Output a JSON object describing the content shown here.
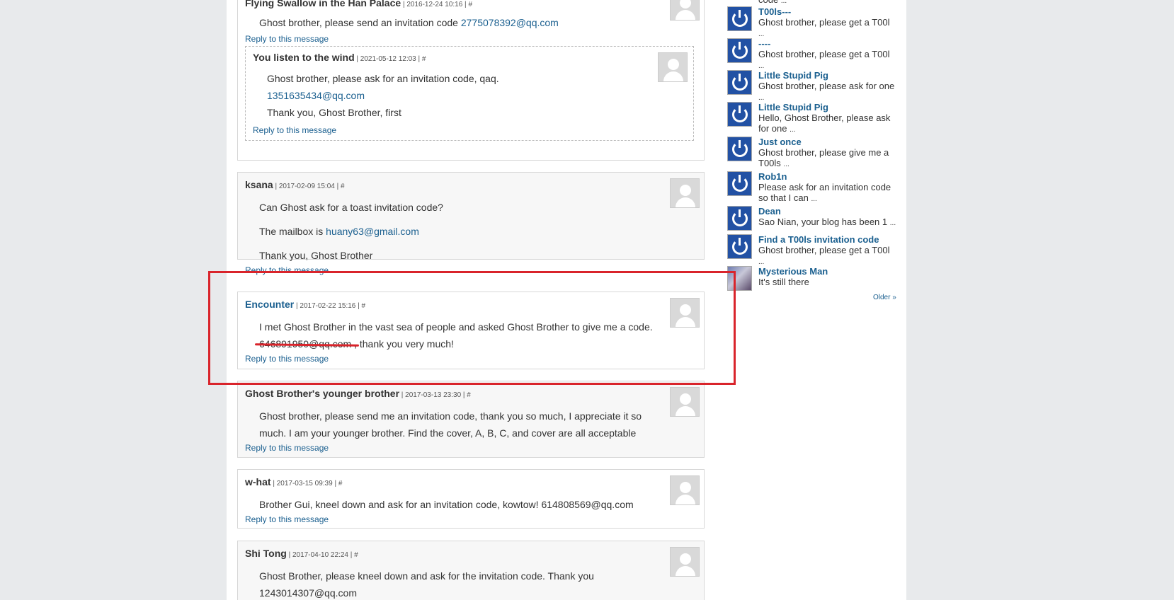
{
  "top_comment": {
    "author": "Flying Swallow in the Han Palace",
    "meta": " | 2016-12-24 10:16 | ",
    "hash": "#",
    "body_text": "Ghost brother, please send an invitation code ",
    "body_email": "2775078392@qq.com",
    "reply": "Reply to this message",
    "nested": {
      "author": "You listen to the wind",
      "meta": " | 2021-05-12 12:03 | ",
      "hash": "#",
      "line1": "Ghost brother, please ask for an invitation code, qaq.",
      "email": "1351635434@qq.com",
      "line3": "Thank you, Ghost Brother, first",
      "reply": "Reply to this message"
    }
  },
  "comments": [
    {
      "author": "ksana",
      "meta": " | 2017-02-09 15:04 | ",
      "hash": "#",
      "line1": "Can Ghost ask for a toast invitation code?",
      "line2_prefix": "The mailbox is ",
      "line2_email": "huany63@gmail.com",
      "line3": "Thank you, Ghost Brother",
      "reply": "Reply to this message"
    },
    {
      "author": "Encounter",
      "meta": " | 2017-02-22 15:16 | ",
      "hash": "#",
      "line1": "I met Ghost Brother in the vast sea of people and asked Ghost Brother to give me a code.",
      "line2_email": "646891950@qq.com",
      "line2_suffix": " , thank you very much!",
      "reply": "Reply to this message"
    },
    {
      "author": "Ghost Brother's younger brother",
      "meta": " | 2017-03-13 23:30 | ",
      "hash": "#",
      "line1": "Ghost brother, please send me an invitation code, thank you so much, I appreciate it so",
      "line2": "much. I am your younger brother. Find the cover, A, B, C, and cover are all acceptable",
      "reply": "Reply to this message"
    },
    {
      "author": "w-hat",
      "meta": " | 2017-03-15 09:39 | ",
      "hash": "#",
      "line1": "Brother Gui, kneel down and ask for an invitation code, kowtow! 614808569@qq.com",
      "reply": "Reply to this message"
    },
    {
      "author": "Shi Tong",
      "meta": " | 2017-04-10 22:24 | ",
      "hash": "#",
      "line1": "Ghost Brother, please kneel down and ask for the invitation code. Thank you",
      "line2": "1243014307@qq.com"
    }
  ],
  "sidebar": {
    "top_snippet": "code",
    "items": [
      {
        "name": "T00ls---",
        "snippet": "Ghost brother, please get a T00l"
      },
      {
        "name": "----",
        "snippet": "Ghost brother, please get a T00l"
      },
      {
        "name": "Little Stupid Pig",
        "snippet": "Ghost brother, please ask for one"
      },
      {
        "name": "Little Stupid Pig",
        "snippet": "Hello, Ghost Brother, please ask for one"
      },
      {
        "name": "Just once",
        "snippet": "Ghost brother, please give me a T00ls"
      },
      {
        "name": "Rob1n",
        "snippet": "Please ask for an invitation code so that I can"
      },
      {
        "name": "Dean",
        "snippet": "Sao Nian, your blog has been 1"
      },
      {
        "name": "Find a T00ls invitation code",
        "snippet": "Ghost brother, please get a T00l"
      },
      {
        "name": "Mysterious Man",
        "snippet": "It's still there"
      }
    ],
    "ellipsis": "...",
    "older": "Older »"
  },
  "colors": {
    "link": "#1a5f8f",
    "annotation": "#d9242b",
    "background": "#e8eaec"
  }
}
